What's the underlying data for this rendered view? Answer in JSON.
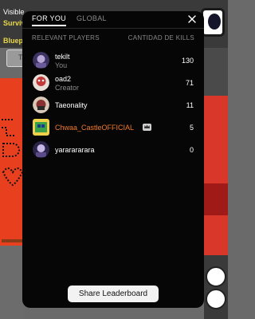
{
  "background": {
    "line1": "Visible",
    "line2": "Surviv",
    "line3": "Bluepr",
    "chip": "Ta"
  },
  "tabs": [
    {
      "label": "FOR YOU",
      "active": true
    },
    {
      "label": "GLOBAL",
      "active": false
    }
  ],
  "close_icon": "close-icon",
  "columns": {
    "left": "RELEVANT PLAYERS",
    "right": "CANTIDAD DE KILLS"
  },
  "players": [
    {
      "name": "tekilt",
      "subtitle": "You",
      "value": "130",
      "avatar_color": "#4a3a6a"
    },
    {
      "name": "oad2",
      "subtitle": "Creator",
      "value": "71",
      "avatar_color": "#c23a3a"
    },
    {
      "name": "Taeonality",
      "subtitle": "",
      "value": "11",
      "avatar_color": "#8a3030"
    },
    {
      "name": "Chwaa_CastleOFFICIAL",
      "subtitle": "",
      "value": "5",
      "avatar_color": "#3aa04a",
      "name_color": "#f07a2a",
      "badge": "crown-badge-icon"
    },
    {
      "name": "yararararara",
      "subtitle": "",
      "value": "0",
      "avatar_color": "#5a4a8a"
    }
  ],
  "share_button": "Share Leaderboard"
}
